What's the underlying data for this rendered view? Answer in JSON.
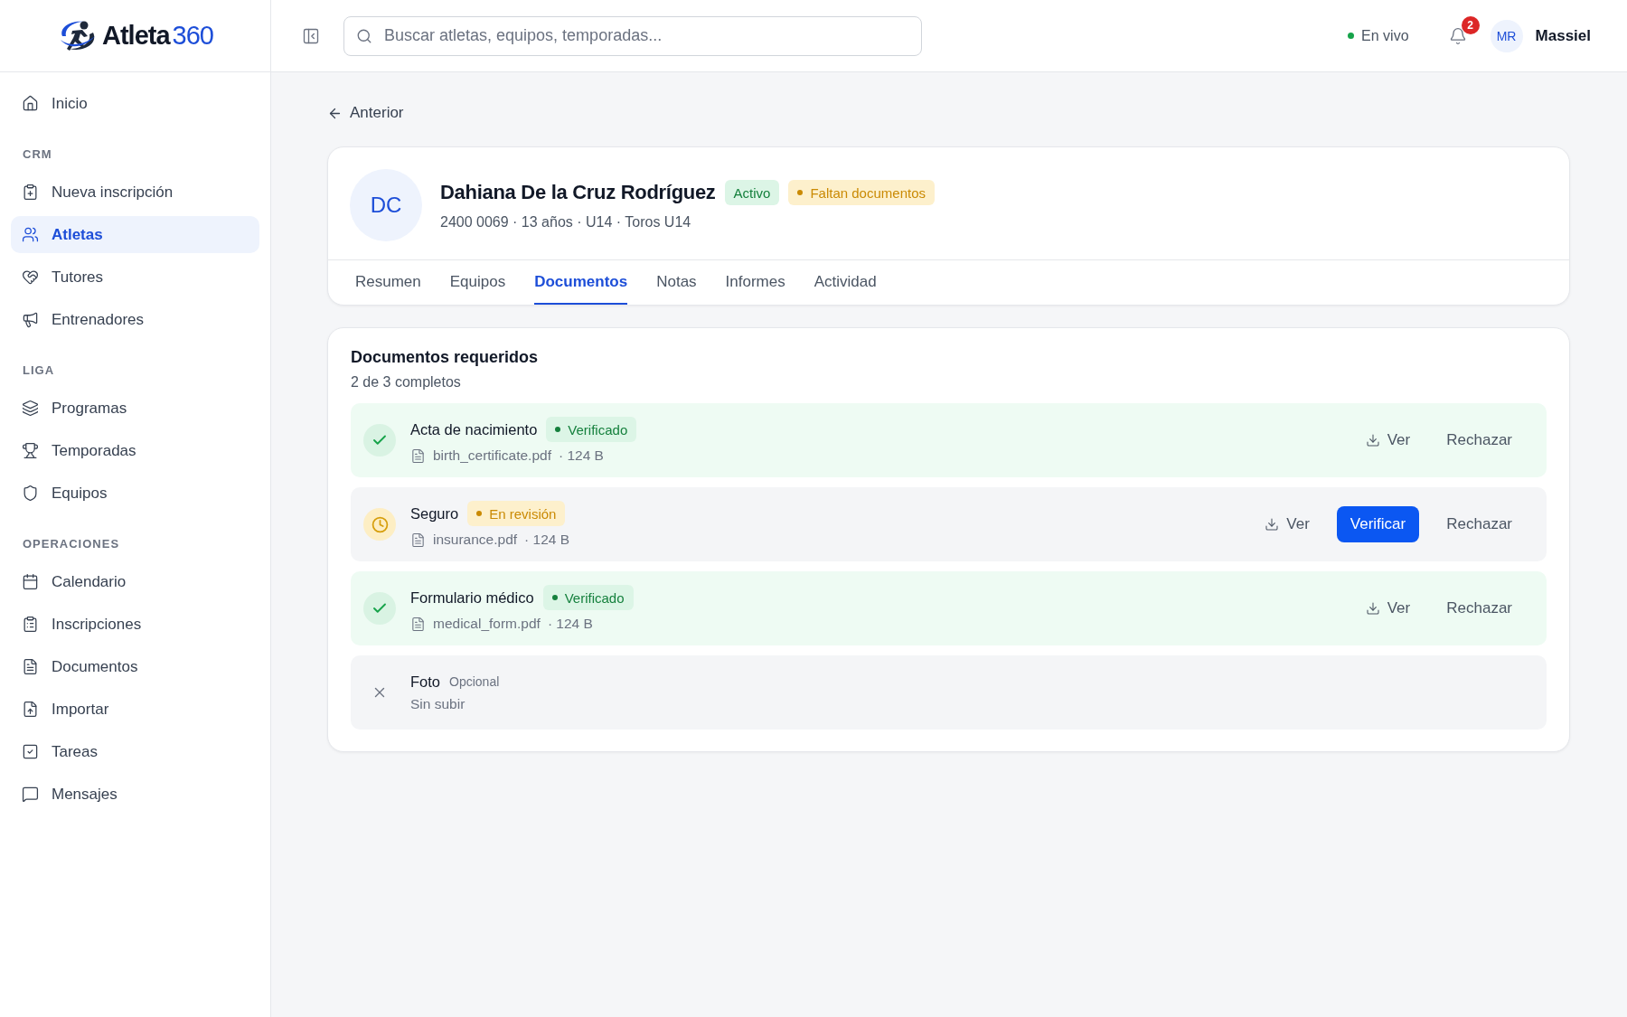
{
  "logo": {
    "name": "Atleta",
    "number": "360"
  },
  "search": {
    "placeholder": "Buscar atletas, equipos, temporadas..."
  },
  "live": {
    "label": "En vivo",
    "color": "#16a34a"
  },
  "notifications": {
    "count": "2"
  },
  "user": {
    "initials": "MR",
    "name": "Massiel"
  },
  "sidebar": {
    "items": [
      {
        "label": "Inicio",
        "selected": false
      }
    ],
    "groups": [
      {
        "label": "CRM",
        "items": [
          {
            "label": "Nueva inscripción",
            "selected": false
          },
          {
            "label": "Atletas",
            "selected": true
          },
          {
            "label": "Tutores",
            "selected": false
          },
          {
            "label": "Entrenadores",
            "selected": false
          }
        ]
      },
      {
        "label": "LIGA",
        "items": [
          {
            "label": "Programas",
            "selected": false
          },
          {
            "label": "Temporadas",
            "selected": false
          },
          {
            "label": "Equipos",
            "selected": false
          }
        ]
      },
      {
        "label": "OPERACIONES",
        "items": [
          {
            "label": "Calendario",
            "selected": false
          },
          {
            "label": "Inscripciones",
            "selected": false
          },
          {
            "label": "Documentos",
            "selected": false
          },
          {
            "label": "Importar",
            "selected": false
          },
          {
            "label": "Tareas",
            "selected": false
          },
          {
            "label": "Mensajes",
            "selected": false
          }
        ]
      }
    ]
  },
  "back": {
    "label": "Anterior"
  },
  "profile": {
    "initials": "DC",
    "name": "Dahiana De la Cruz Rodríguez",
    "meta": "2400 0069 · 13 años · U14 · Toros U14",
    "badges": [
      {
        "label": "Activo",
        "kind": "success",
        "dot": false
      },
      {
        "label": "Faltan documentos",
        "kind": "warning",
        "dot": true
      }
    ],
    "tabs": [
      {
        "label": "Resumen",
        "selected": false
      },
      {
        "label": "Equipos",
        "selected": false
      },
      {
        "label": "Documentos",
        "selected": true
      },
      {
        "label": "Notas",
        "selected": false
      },
      {
        "label": "Informes",
        "selected": false
      },
      {
        "label": "Actividad",
        "selected": false
      }
    ]
  },
  "documents": {
    "title": "Documentos requeridos",
    "subtitle": "2 de 3 completos",
    "rows": [
      {
        "kind": "verified",
        "name": "Acta de nacimiento",
        "badge": "Verificado",
        "file": "birth_certificate.pdf",
        "size": "· 124 B",
        "actions": [
          {
            "kind": "download",
            "label": "Ver"
          },
          {
            "kind": "text",
            "label": "Rechazar"
          }
        ]
      },
      {
        "kind": "review",
        "name": "Seguro",
        "badge": "En revisión",
        "file": "insurance.pdf",
        "size": "· 124 B",
        "actions": [
          {
            "kind": "download",
            "label": "Ver"
          },
          {
            "kind": "primary",
            "label": "Verificar"
          },
          {
            "kind": "text",
            "label": "Rechazar"
          }
        ]
      },
      {
        "kind": "verified",
        "name": "Formulario médico",
        "badge": "Verificado",
        "file": "medical_form.pdf",
        "size": "· 124 B",
        "actions": [
          {
            "kind": "download",
            "label": "Ver"
          },
          {
            "kind": "text",
            "label": "Rechazar"
          }
        ]
      },
      {
        "kind": "missing",
        "name": "Foto",
        "tag": "Opcional",
        "note": "Sin subir"
      }
    ]
  }
}
